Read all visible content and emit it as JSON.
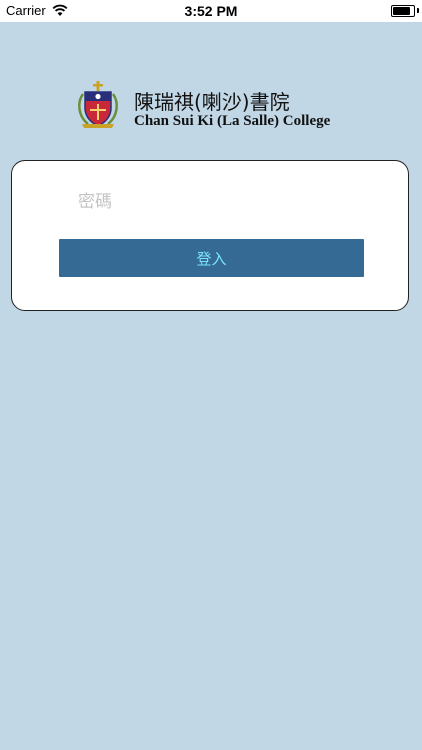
{
  "status_bar": {
    "carrier": "Carrier",
    "time": "3:52 PM",
    "battery_level": 0.95
  },
  "brand": {
    "name_zh": "陳瑞祺(喇沙)書院",
    "name_en": "Chan Sui Ki (La Salle) College",
    "crest_icon": "school-crest-icon"
  },
  "login": {
    "password_placeholder": "密碼",
    "password_value": "",
    "login_label": "登入"
  },
  "colors": {
    "background": "#c1d7e6",
    "button": "#346a93",
    "button_text": "#7be3ff",
    "crest_red": "#c8283a",
    "crest_navy": "#2a2f7a",
    "crest_gold": "#c9a227"
  }
}
